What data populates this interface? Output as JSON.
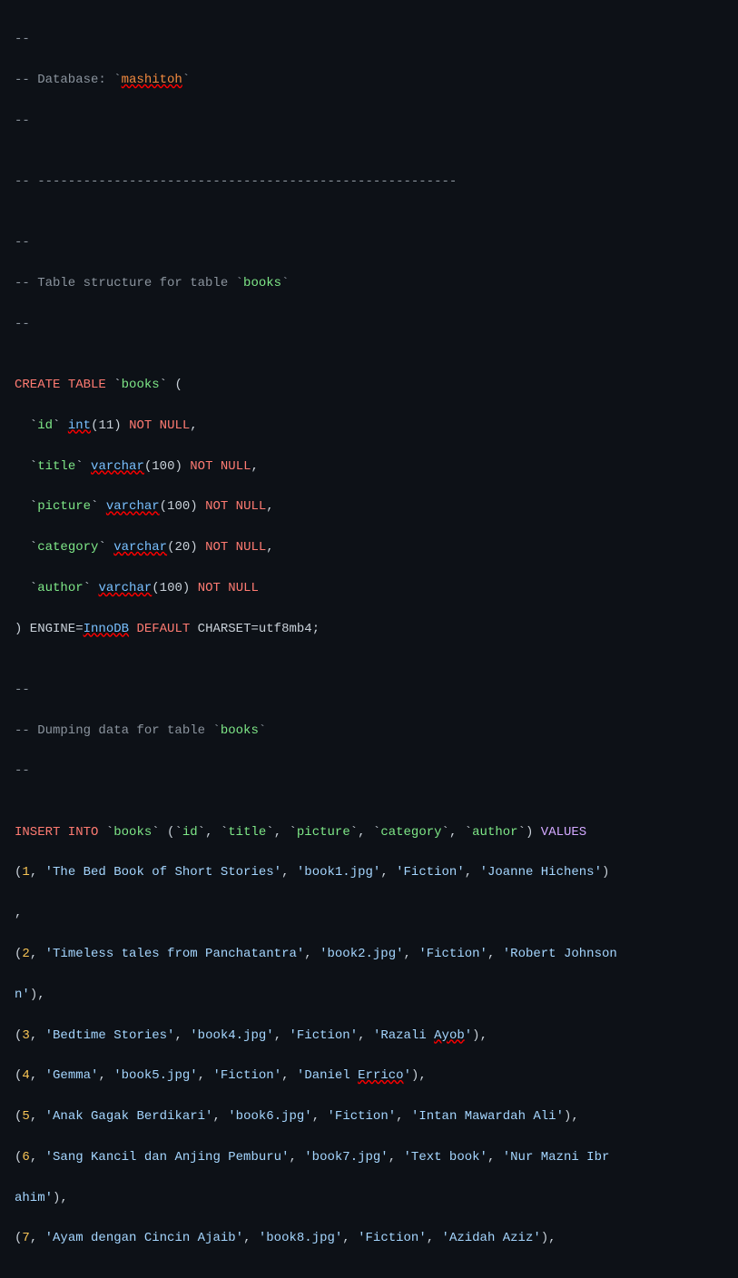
{
  "code": {
    "lines": [
      {
        "id": 1,
        "content": "--"
      },
      {
        "id": 2,
        "content": "-- Database: `mashitoh`"
      },
      {
        "id": 3,
        "content": "--"
      },
      {
        "id": 4,
        "content": ""
      },
      {
        "id": 5,
        "content": "-- -------------------------------------------------------"
      },
      {
        "id": 6,
        "content": ""
      },
      {
        "id": 7,
        "content": "--"
      },
      {
        "id": 8,
        "content": "-- Table structure for table `books`"
      },
      {
        "id": 9,
        "content": "--"
      },
      {
        "id": 10,
        "content": ""
      },
      {
        "id": 11,
        "content": "CREATE TABLE `books` ("
      },
      {
        "id": 12,
        "content": "  `id` int(11) NOT NULL,"
      },
      {
        "id": 13,
        "content": "  `title` varchar(100) NOT NULL,"
      },
      {
        "id": 14,
        "content": "  `picture` varchar(100) NOT NULL,"
      },
      {
        "id": 15,
        "content": "  `category` varchar(20) NOT NULL,"
      },
      {
        "id": 16,
        "content": "  `author` varchar(100) NOT NULL"
      },
      {
        "id": 17,
        "content": ") ENGINE=InnoDB DEFAULT CHARSET=utf8mb4;"
      },
      {
        "id": 18,
        "content": ""
      },
      {
        "id": 19,
        "content": "--"
      },
      {
        "id": 20,
        "content": "-- Dumping data for table `books`"
      },
      {
        "id": 21,
        "content": "--"
      },
      {
        "id": 22,
        "content": ""
      },
      {
        "id": 23,
        "content": "INSERT INTO `books` (`id`, `title`, `picture`, `category`, `author`) VALUES"
      },
      {
        "id": 24,
        "content": "(1, 'The Bed Book of Short Stories', 'book1.jpg', 'Fiction', 'Joanne Hichens')"
      },
      {
        "id": 25,
        "content": ","
      },
      {
        "id": 26,
        "content": "(2, 'Timeless tales from Panchatantra', 'book2.jpg', 'Fiction', 'Robert Johnson'),"
      },
      {
        "id": 27,
        "content": "(3, 'Bedtime Stories', 'book4.jpg', 'Fiction', 'Razali Ayob'),"
      },
      {
        "id": 28,
        "content": "(4, 'Gemma', 'book5.jpg', 'Fiction', 'Daniel Errico'),"
      },
      {
        "id": 29,
        "content": "(5, 'Anak Gagak Berdikari', 'book6.jpg', 'Fiction', 'Intan Mawardah Ali'),"
      },
      {
        "id": 30,
        "content": "(6, 'Sang Kancil dan Anjing Pemburu', 'book7.jpg', 'Text book', 'Nur Mazni Ibrahim'),"
      },
      {
        "id": 31,
        "content": "(7, 'Ayam dengan Cincin Ajaib', 'book8.jpg', 'Fiction', 'Azidah Aziz'),"
      }
    ]
  }
}
